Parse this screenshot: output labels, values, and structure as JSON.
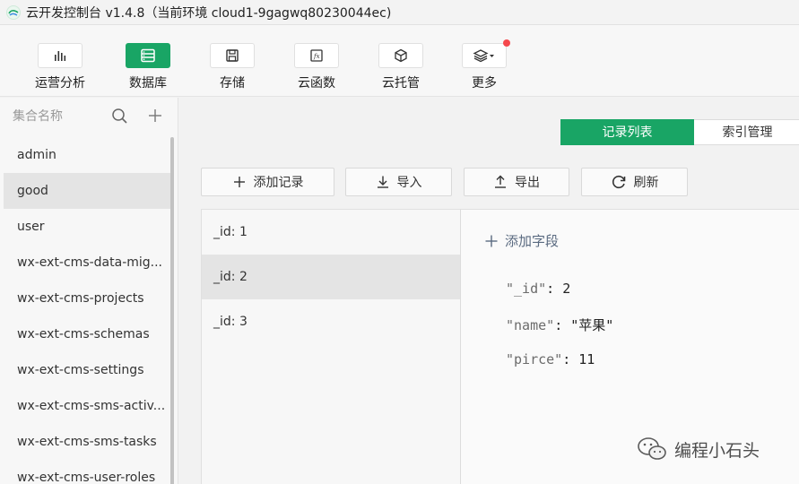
{
  "window": {
    "title": "云开发控制台 v1.4.8（当前环境 cloud1-9gagwq80230044ec)"
  },
  "toolbar": {
    "items": [
      {
        "label": "运营分析",
        "icon": "bar-chart-icon"
      },
      {
        "label": "数据库",
        "icon": "database-icon",
        "active": true
      },
      {
        "label": "存储",
        "icon": "save-icon"
      },
      {
        "label": "云函数",
        "icon": "function-icon"
      },
      {
        "label": "云托管",
        "icon": "cube-icon"
      },
      {
        "label": "更多",
        "icon": "layers-icon",
        "badge": true
      }
    ]
  },
  "sidebar": {
    "placeholder": "集合名称",
    "collections": [
      {
        "label": "admin"
      },
      {
        "label": "good",
        "active": true
      },
      {
        "label": "user"
      },
      {
        "label": "wx-ext-cms-data-mig..."
      },
      {
        "label": "wx-ext-cms-projects"
      },
      {
        "label": "wx-ext-cms-schemas"
      },
      {
        "label": "wx-ext-cms-settings"
      },
      {
        "label": "wx-ext-cms-sms-activ..."
      },
      {
        "label": "wx-ext-cms-sms-tasks"
      },
      {
        "label": "wx-ext-cms-user-roles"
      }
    ]
  },
  "tabs": {
    "records": "记录列表",
    "indexes": "索引管理"
  },
  "actions": {
    "add": "添加记录",
    "import": "导入",
    "export": "导出",
    "refresh": "刷新"
  },
  "records": [
    {
      "label": "_id: 1"
    },
    {
      "label": "_id: 2",
      "active": true
    },
    {
      "label": "_id: 3"
    }
  ],
  "detail": {
    "add_field": "添加字段",
    "fields": [
      {
        "key": "\"_id\"",
        "value": "2"
      },
      {
        "key": "\"name\"",
        "value": "\"苹果\""
      },
      {
        "key": "\"pirce\"",
        "value": "11"
      }
    ]
  },
  "watermark": {
    "text": "编程小石头"
  },
  "colors": {
    "accent": "#19a565",
    "badge": "#f5484d"
  }
}
